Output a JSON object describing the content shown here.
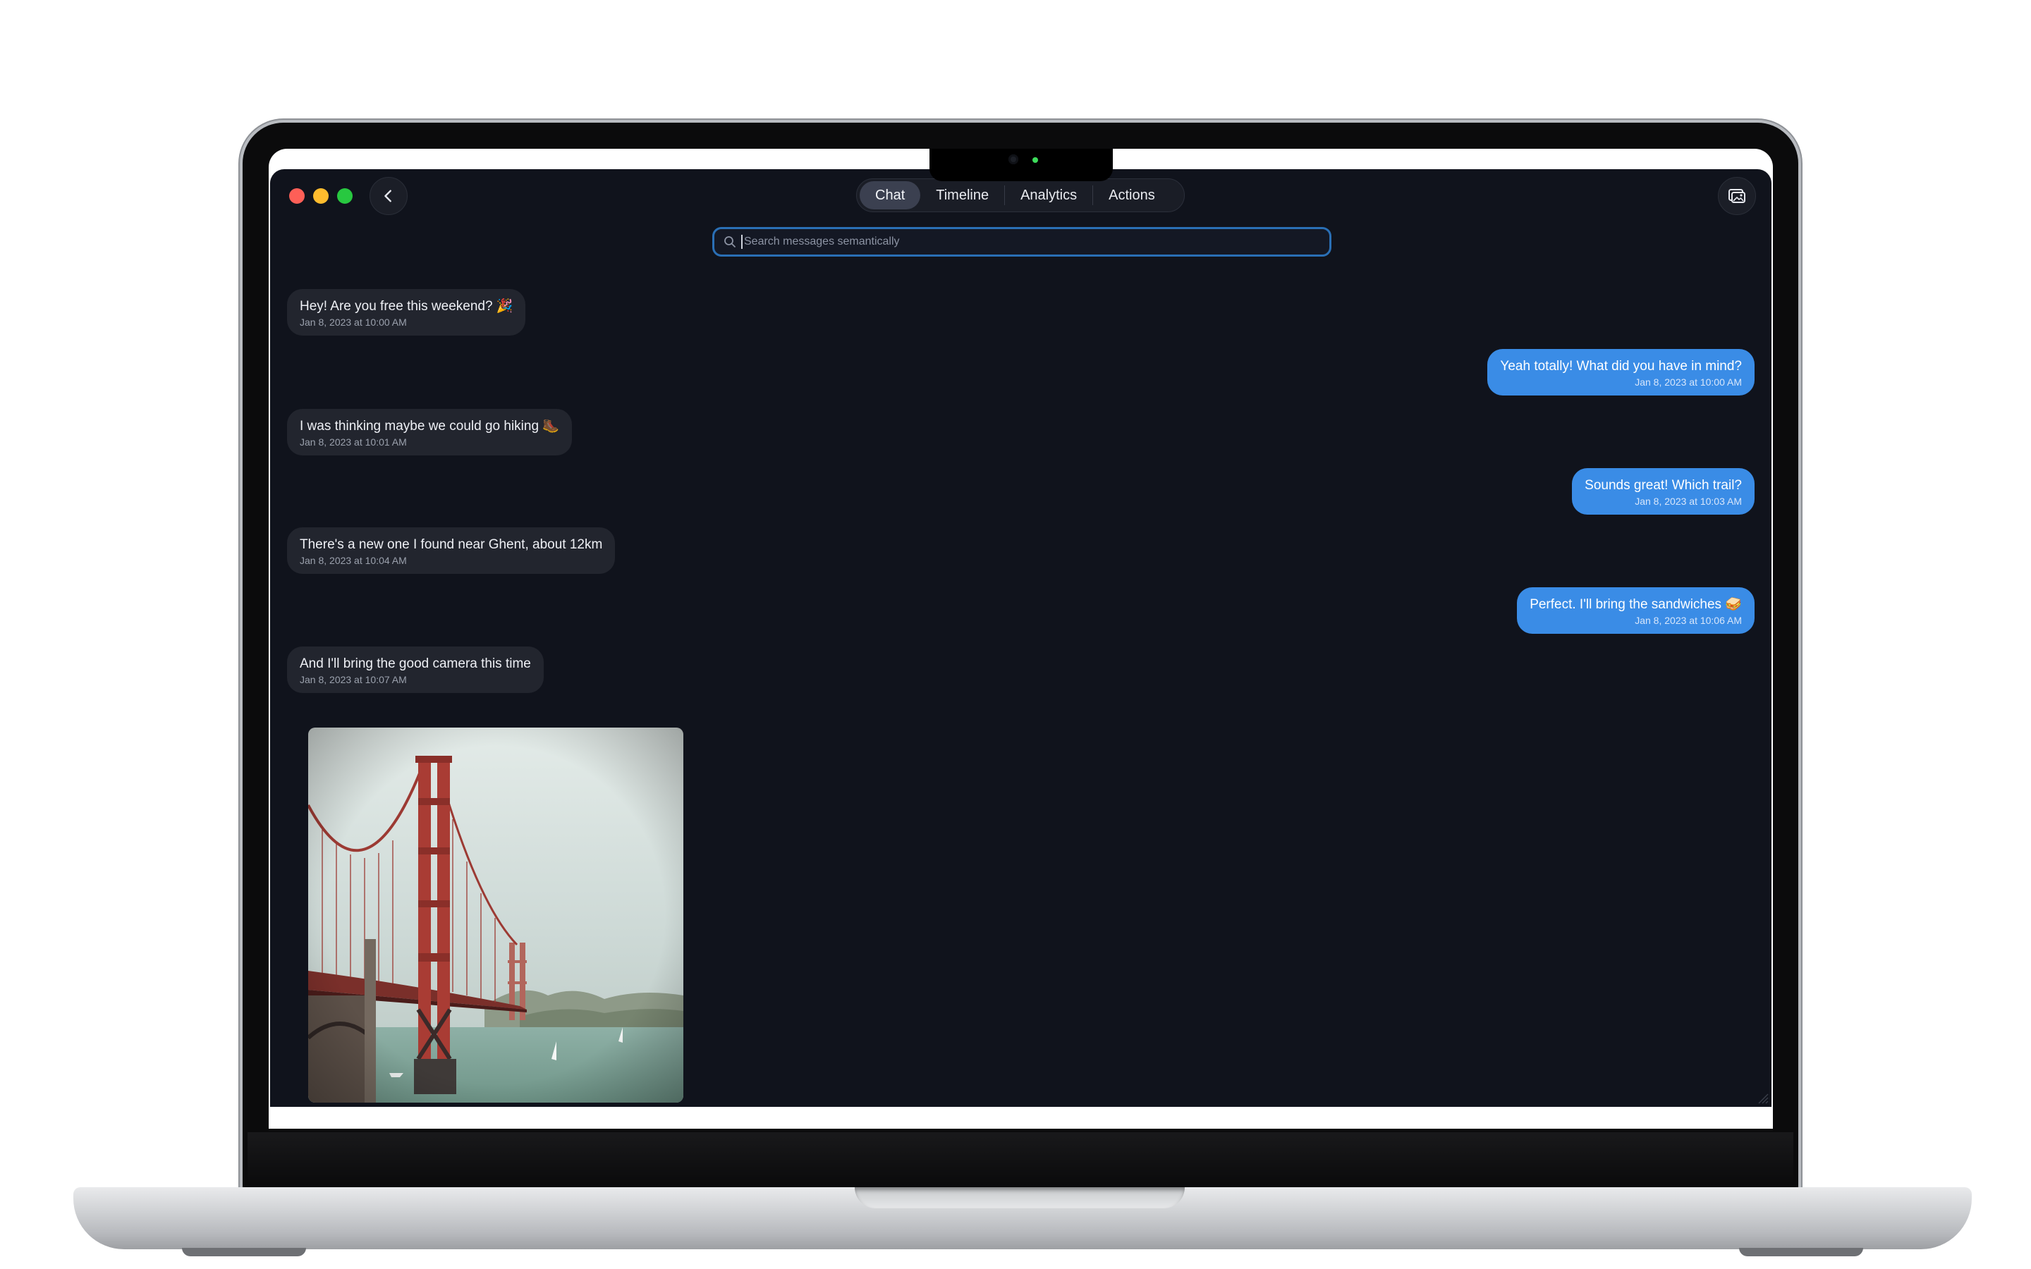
{
  "tabs": [
    {
      "label": "Chat",
      "active": true
    },
    {
      "label": "Timeline",
      "active": false
    },
    {
      "label": "Analytics",
      "active": false
    },
    {
      "label": "Actions",
      "active": false
    }
  ],
  "search": {
    "placeholder": "Search messages semantically",
    "value": ""
  },
  "messages": [
    {
      "direction": "in",
      "text": "Hey! Are you free this weekend? 🎉",
      "time": "Jan 8, 2023 at 10:00 AM"
    },
    {
      "direction": "out",
      "text": "Yeah totally! What did you have in mind?",
      "time": "Jan 8, 2023 at 10:00 AM"
    },
    {
      "direction": "in",
      "text": "I was thinking maybe we could go hiking 🥾",
      "time": "Jan 8, 2023 at 10:01 AM"
    },
    {
      "direction": "out",
      "text": "Sounds great! Which trail?",
      "time": "Jan 8, 2023 at 10:03 AM"
    },
    {
      "direction": "in",
      "text": "There's a new one I found near Ghent, about 12km",
      "time": "Jan 8, 2023 at 10:04 AM"
    },
    {
      "direction": "out",
      "text": "Perfect. I'll bring the sandwiches 🥪",
      "time": "Jan 8, 2023 at 10:06 AM"
    },
    {
      "direction": "in",
      "text": "And I'll bring the good camera this time",
      "time": "Jan 8, 2023 at 10:07 AM"
    }
  ],
  "attachment": {
    "type": "image",
    "subject": "golden-gate-bridge"
  },
  "colors": {
    "window_bg": "#10131c",
    "incoming_bubble": "#22252e",
    "outgoing_bubble": "#3a8ce6",
    "search_border": "#2a6fb5"
  },
  "icons": {
    "back": "chevron-left-icon",
    "gallery": "photo-gallery-icon",
    "search": "magnifier-icon"
  }
}
